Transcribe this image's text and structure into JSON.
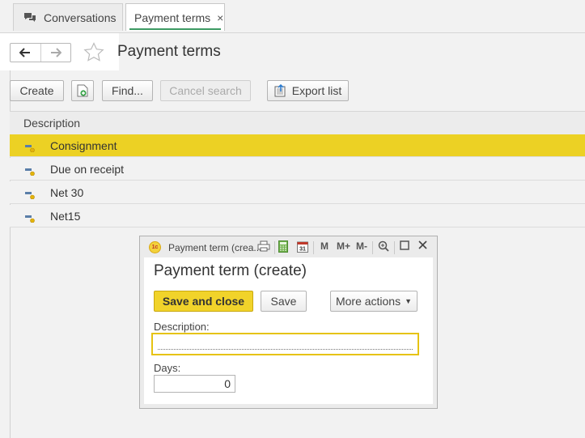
{
  "tabs": [
    {
      "label": "Conversations",
      "icon": "conversations-icon"
    },
    {
      "label": "Payment terms",
      "icon": "close-icon",
      "active": true
    }
  ],
  "tab_close_glyph": "×",
  "page": {
    "title": "Payment terms"
  },
  "toolbar": {
    "create_label": "Create",
    "find_label": "Find...",
    "cancel_search_label": "Cancel search",
    "export_list_label": "Export list"
  },
  "table": {
    "header": "Description",
    "rows": [
      {
        "label": "Consignment",
        "selected": true
      },
      {
        "label": "Due on receipt"
      },
      {
        "label": "Net 30"
      },
      {
        "label": "Net15"
      }
    ]
  },
  "dialog": {
    "window_title": "Payment term (crea...",
    "heading": "Payment term (create)",
    "logo_text": "1c",
    "title_icons": {
      "m": "M",
      "m_plus": "M+",
      "m_minus": "M-"
    },
    "save_close_label": "Save and close",
    "save_label": "Save",
    "more_actions_label": "More actions",
    "description_label": "Description:",
    "description_value": "",
    "days_label": "Days:",
    "days_value": "0"
  },
  "colors": {
    "selection": "#ecd124",
    "primary_button": "#f1d32a",
    "active_tab_underline": "#3c9a63",
    "background": "#f2f2f2"
  }
}
